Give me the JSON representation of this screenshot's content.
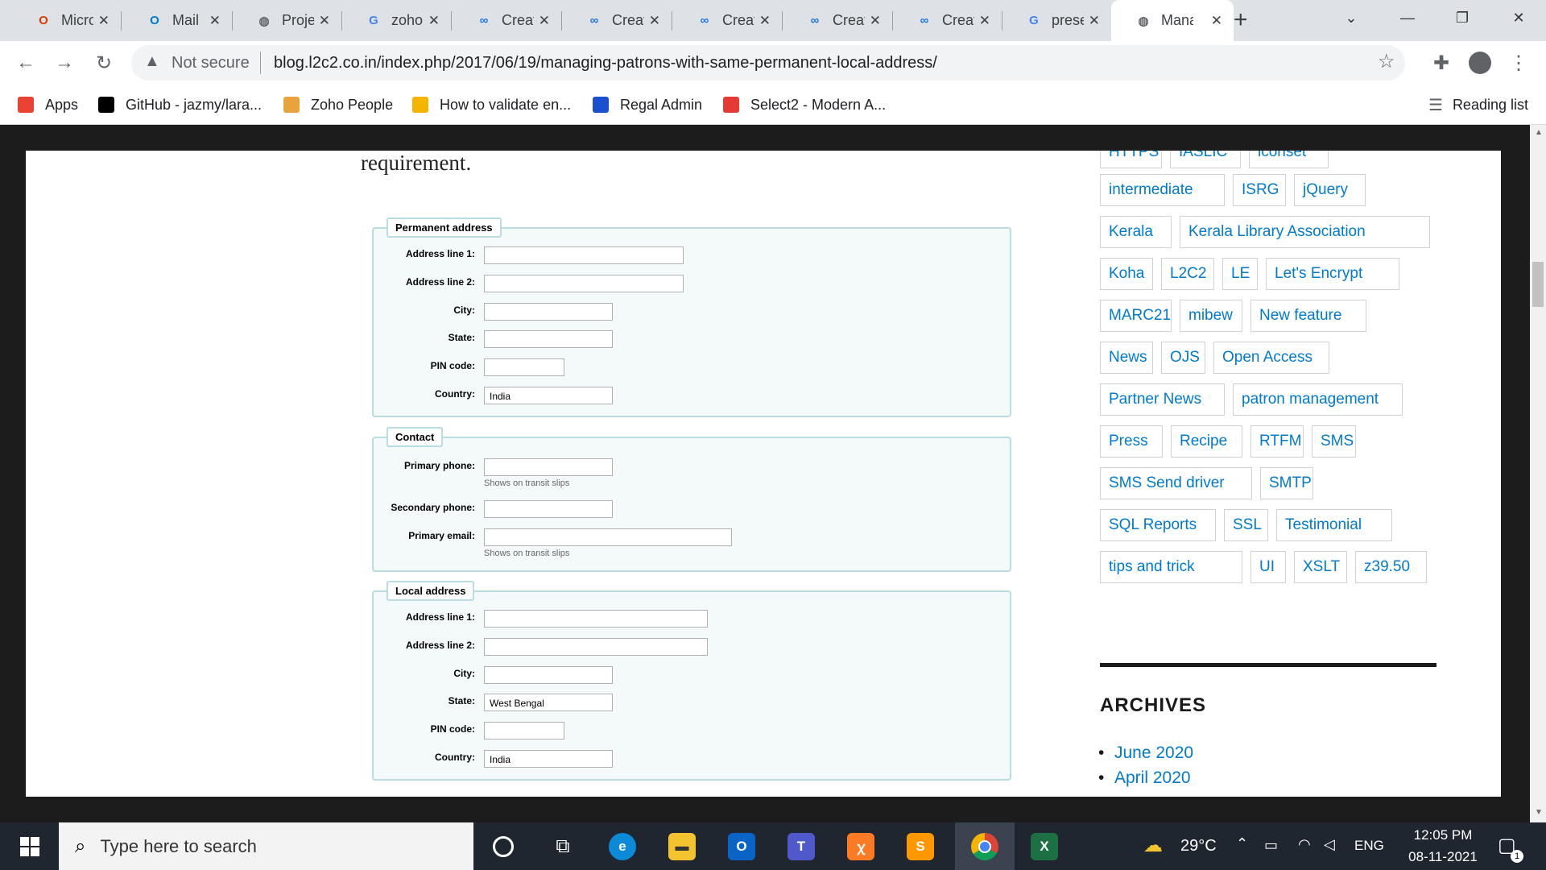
{
  "browser": {
    "tabs": [
      {
        "title": "Micro",
        "icon": "office-icon",
        "color": "#d83b01",
        "glyph": "O"
      },
      {
        "title": "Mail",
        "icon": "outlook-icon",
        "color": "#0078d4",
        "glyph": "O"
      },
      {
        "title": "Proje",
        "icon": "globe-icon",
        "color": "#5f6368",
        "glyph": "◍"
      },
      {
        "title": "zoho",
        "icon": "google-icon",
        "color": "#4285f4",
        "glyph": "G"
      },
      {
        "title": "Creat",
        "icon": "zoho-icon",
        "color": "#1a73e8",
        "glyph": "∞"
      },
      {
        "title": "Creat",
        "icon": "zoho-icon",
        "color": "#1a73e8",
        "glyph": "∞"
      },
      {
        "title": "Creat",
        "icon": "zoho-icon",
        "color": "#1a73e8",
        "glyph": "∞"
      },
      {
        "title": "Creat",
        "icon": "zoho-icon",
        "color": "#1a73e8",
        "glyph": "∞"
      },
      {
        "title": "Creat",
        "icon": "zoho-icon",
        "color": "#1a73e8",
        "glyph": "∞"
      },
      {
        "title": "prese",
        "icon": "google-icon",
        "color": "#4285f4",
        "glyph": "G"
      },
      {
        "title": "Mana",
        "icon": "globe-icon",
        "color": "#5f6368",
        "glyph": "◍",
        "active": true
      }
    ],
    "security_label": "Not secure",
    "url": "blog.l2c2.co.in/index.php/2017/06/19/managing-patrons-with-same-permanent-local-address/",
    "bookmarks": [
      {
        "label": "Apps",
        "icon": "apps-grid-icon",
        "color": "#ea4335"
      },
      {
        "label": "GitHub - jazmy/lara...",
        "icon": "github-icon",
        "color": "#000000"
      },
      {
        "label": "Zoho People",
        "icon": "zoho-people-icon",
        "color": "#e8a33d"
      },
      {
        "label": "How to validate en...",
        "icon": "bookmark-site-icon",
        "color": "#f4b400"
      },
      {
        "label": "Regal Admin",
        "icon": "regal-b-icon",
        "color": "#1a4fd0"
      },
      {
        "label": "Select2 - Modern A...",
        "icon": "select2-icon",
        "color": "#e53935"
      }
    ],
    "reading_list": "Reading list"
  },
  "article": {
    "requirement_text": "requirement.",
    "permanent": {
      "legend": "Permanent address",
      "labels": [
        "Address line 1:",
        "Address line 2:",
        "City:",
        "State:",
        "PIN code:",
        "Country:"
      ],
      "values": [
        "",
        "",
        "",
        "",
        "",
        "India"
      ]
    },
    "contact": {
      "legend": "Contact",
      "labels": [
        "Primary phone:",
        "Secondary phone:",
        "Primary email:"
      ],
      "hint": "Shows on transit slips"
    },
    "local": {
      "legend": "Local address",
      "labels": [
        "Address line 1:",
        "Address line 2:",
        "City:",
        "State:",
        "PIN code:",
        "Country:"
      ],
      "values": [
        "",
        "",
        "",
        "West Bengal",
        "",
        "India"
      ]
    }
  },
  "sidebar": {
    "tags_partial": [
      "HTTPS",
      "IASLIC",
      "iconset"
    ],
    "tags": [
      [
        "intermediate",
        "ISRG",
        "jQuery"
      ],
      [
        "Kerala",
        "Kerala Library Association"
      ],
      [
        "Koha",
        "L2C2",
        "LE",
        "Let's Encrypt"
      ],
      [
        "MARC21",
        "mibew",
        "New feature"
      ],
      [
        "News",
        "OJS",
        "Open Access"
      ],
      [
        "Partner News",
        "patron management"
      ],
      [
        "Press",
        "Recipe",
        "RTFM",
        "SMS"
      ],
      [
        "SMS Send driver",
        "SMTP"
      ],
      [
        "SQL Reports",
        "SSL",
        "Testimonial"
      ],
      [
        "tips and trick",
        "UI",
        "XSLT",
        "z39.50"
      ]
    ],
    "archives_title": "ARCHIVES",
    "archives": [
      "June 2020",
      "April 2020"
    ]
  },
  "taskbar": {
    "search_placeholder": "Type here to search",
    "weather": "29°C",
    "language": "ENG",
    "time": "12:05 PM",
    "date": "08-11-2021",
    "notification_count": "1"
  }
}
